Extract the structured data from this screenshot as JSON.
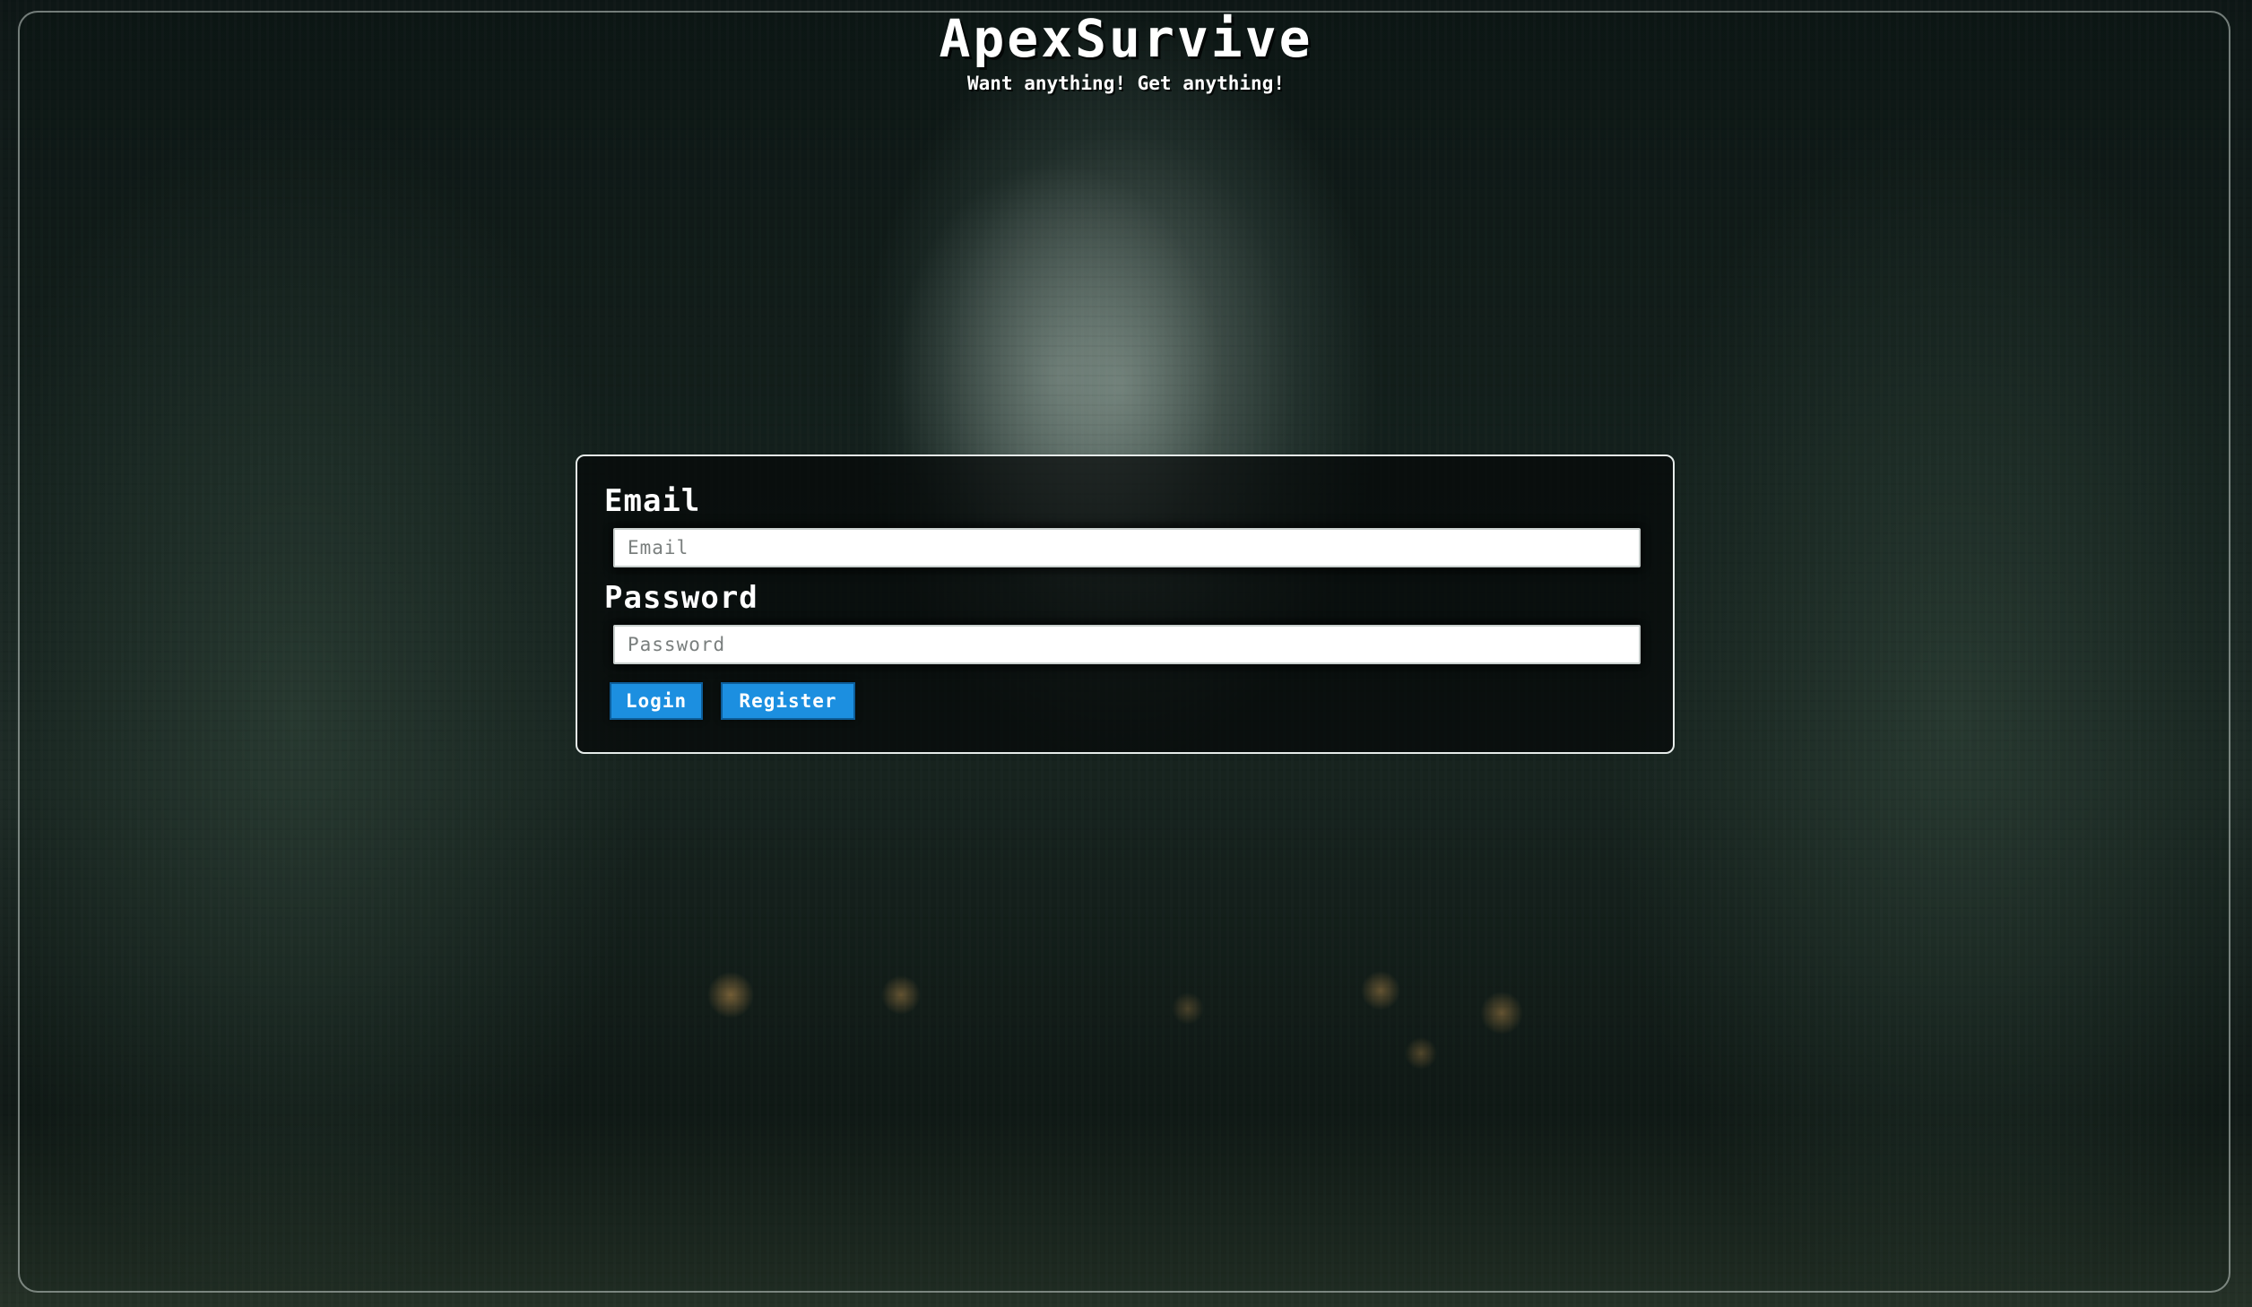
{
  "header": {
    "title": "ApexSurvive",
    "tagline": "Want anything! Get anything!"
  },
  "login_form": {
    "email_label": "Email",
    "email_placeholder": "Email",
    "email_value": "",
    "password_label": "Password",
    "password_placeholder": "Password",
    "password_value": "",
    "login_button": "Login",
    "register_button": "Register"
  },
  "colors": {
    "button_bg": "#1c8fe0",
    "panel_border": "#e6ecea",
    "text": "#ffffff"
  }
}
